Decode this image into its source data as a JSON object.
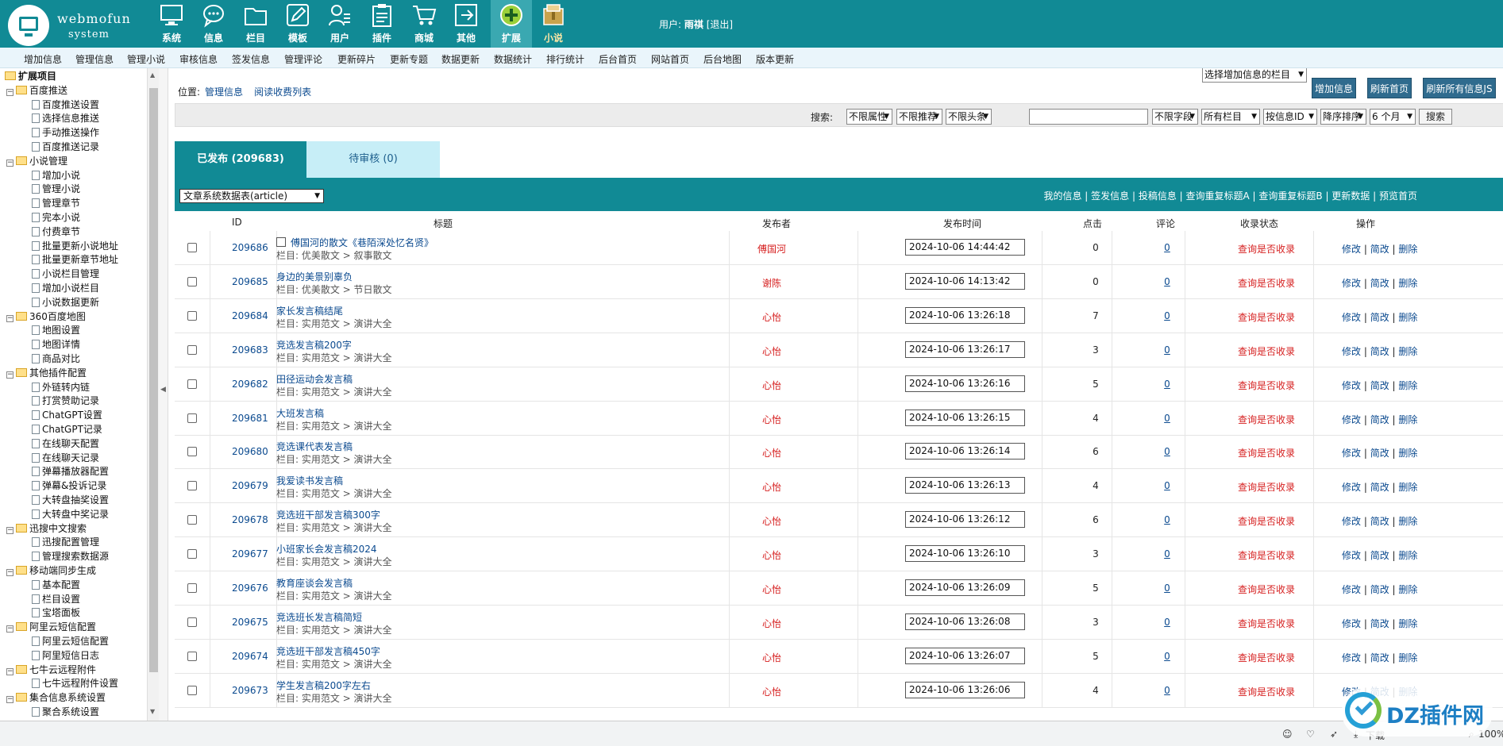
{
  "logo": {
    "name": "webmofun",
    "sub": "system"
  },
  "top_modules": [
    {
      "label": "系统",
      "icon": "monitor-icon"
    },
    {
      "label": "信息",
      "icon": "chat-icon"
    },
    {
      "label": "栏目",
      "icon": "folder-icon"
    },
    {
      "label": "模板",
      "icon": "pencil-icon"
    },
    {
      "label": "用户",
      "icon": "user-icon"
    },
    {
      "label": "插件",
      "icon": "clipboard-icon"
    },
    {
      "label": "商城",
      "icon": "cart-icon"
    },
    {
      "label": "其他",
      "icon": "exit-icon"
    },
    {
      "label": "扩展",
      "icon": "plus-circle-icon"
    },
    {
      "label": "小说",
      "icon": "book-box-icon"
    }
  ],
  "user": {
    "prefix": "用户:",
    "name": "雨祺",
    "logout": "[退出]"
  },
  "menu": [
    "增加信息",
    "管理信息",
    "管理小说",
    "审核信息",
    "签发信息",
    "管理评论",
    "更新碎片",
    "更新专题",
    "数据更新",
    "数据统计",
    "排行统计",
    "后台首页",
    "网站首页",
    "后台地图",
    "版本更新"
  ],
  "tree": [
    {
      "label": "扩展项目",
      "level": 0
    },
    {
      "label": "百度推送",
      "level": 1
    },
    {
      "label": "百度推送设置",
      "level": 2
    },
    {
      "label": "选择信息推送",
      "level": 2
    },
    {
      "label": "手动推送操作",
      "level": 2
    },
    {
      "label": "百度推送记录",
      "level": 2
    },
    {
      "label": "小说管理",
      "level": 1
    },
    {
      "label": "增加小说",
      "level": 2
    },
    {
      "label": "管理小说",
      "level": 2
    },
    {
      "label": "管理章节",
      "level": 2
    },
    {
      "label": "完本小说",
      "level": 2
    },
    {
      "label": "付费章节",
      "level": 2
    },
    {
      "label": "批量更新小说地址",
      "level": 2
    },
    {
      "label": "批量更新章节地址",
      "level": 2
    },
    {
      "label": "小说栏目管理",
      "level": 2
    },
    {
      "label": "增加小说栏目",
      "level": 2
    },
    {
      "label": "小说数据更新",
      "level": 2
    },
    {
      "label": "360百度地图",
      "level": 1
    },
    {
      "label": "地图设置",
      "level": 2
    },
    {
      "label": "地图详情",
      "level": 2
    },
    {
      "label": "商品对比",
      "level": 2
    },
    {
      "label": "其他插件配置",
      "level": 1
    },
    {
      "label": "外链转内链",
      "level": 2
    },
    {
      "label": "打赏赞助记录",
      "level": 2
    },
    {
      "label": "ChatGPT设置",
      "level": 2
    },
    {
      "label": "ChatGPT记录",
      "level": 2
    },
    {
      "label": "在线聊天配置",
      "level": 2
    },
    {
      "label": "在线聊天记录",
      "level": 2
    },
    {
      "label": "弹幕播放器配置",
      "level": 2
    },
    {
      "label": "弹幕&投诉记录",
      "level": 2
    },
    {
      "label": "大转盘抽奖设置",
      "level": 2
    },
    {
      "label": "大转盘中奖记录",
      "level": 2
    },
    {
      "label": "迅搜中文搜索",
      "level": 1
    },
    {
      "label": "迅搜配置管理",
      "level": 2
    },
    {
      "label": "管理搜索数据源",
      "level": 2
    },
    {
      "label": "移动端同步生成",
      "level": 1
    },
    {
      "label": "基本配置",
      "level": 2
    },
    {
      "label": "栏目设置",
      "level": 2
    },
    {
      "label": "宝塔面板",
      "level": 2
    },
    {
      "label": "阿里云短信配置",
      "level": 1
    },
    {
      "label": "阿里云短信配置",
      "level": 2
    },
    {
      "label": "阿里短信日志",
      "level": 2
    },
    {
      "label": "七牛云远程附件",
      "level": 1
    },
    {
      "label": "七牛远程附件设置",
      "level": 2
    },
    {
      "label": "集合信息系统设置",
      "level": 1
    },
    {
      "label": "聚合系统设置",
      "level": 2
    }
  ],
  "breadcrumb": {
    "label": "位置:",
    "items": [
      "管理信息",
      "阅读收费列表"
    ]
  },
  "toolbar": {
    "add_select": "选择增加信息的栏目",
    "add_btn": "增加信息",
    "refresh_home": "刷新首页",
    "refresh_js": "刷新所有信息JS"
  },
  "search": {
    "label": "搜索:",
    "filters": [
      "不限属性",
      "不限推荐",
      "不限头条"
    ],
    "keyword": "",
    "field": "不限字段",
    "column": "所有栏目",
    "order_by": "按信息ID",
    "order": "降序排序",
    "period": "6 个月",
    "button": "搜索"
  },
  "tabs": {
    "published": "已发布 (209683)",
    "pending": "待审核 (0)"
  },
  "table_select": "文章系统数据表(article)",
  "table_links": [
    "我的信息",
    "签发信息",
    "投稿信息",
    "查询重复标题A",
    "查询重复标题B",
    "更新数据",
    "预览首页"
  ],
  "columns": [
    "ID",
    "标题",
    "发布者",
    "发布时间",
    "点击",
    "评论",
    "收录状态",
    "操作"
  ],
  "rows": [
    {
      "id": "209686",
      "title": "傅国河的散文《巷陌深处忆名贤》",
      "cat": "栏目: 优美散文 > 叙事散文",
      "pub": "傅国河",
      "time": "2024-10-06 14:44:42",
      "clicks": "0",
      "comments": "0",
      "status": "查询是否收录",
      "icon": true
    },
    {
      "id": "209685",
      "title": "身边的美景别辜负",
      "cat": "栏目: 优美散文 > 节日散文",
      "pub": "谢陈",
      "time": "2024-10-06 14:13:42",
      "clicks": "0",
      "comments": "0",
      "status": "查询是否收录"
    },
    {
      "id": "209684",
      "title": "家长发言稿结尾",
      "cat": "栏目: 实用范文 > 演讲大全",
      "pub": "心怡",
      "time": "2024-10-06 13:26:18",
      "clicks": "7",
      "comments": "0",
      "status": "查询是否收录"
    },
    {
      "id": "209683",
      "title": "竞选发言稿200字",
      "cat": "栏目: 实用范文 > 演讲大全",
      "pub": "心怡",
      "time": "2024-10-06 13:26:17",
      "clicks": "3",
      "comments": "0",
      "status": "查询是否收录"
    },
    {
      "id": "209682",
      "title": "田径运动会发言稿",
      "cat": "栏目: 实用范文 > 演讲大全",
      "pub": "心怡",
      "time": "2024-10-06 13:26:16",
      "clicks": "5",
      "comments": "0",
      "status": "查询是否收录"
    },
    {
      "id": "209681",
      "title": "大班发言稿",
      "cat": "栏目: 实用范文 > 演讲大全",
      "pub": "心怡",
      "time": "2024-10-06 13:26:15",
      "clicks": "4",
      "comments": "0",
      "status": "查询是否收录"
    },
    {
      "id": "209680",
      "title": "竞选课代表发言稿",
      "cat": "栏目: 实用范文 > 演讲大全",
      "pub": "心怡",
      "time": "2024-10-06 13:26:14",
      "clicks": "6",
      "comments": "0",
      "status": "查询是否收录"
    },
    {
      "id": "209679",
      "title": "我爱读书发言稿",
      "cat": "栏目: 实用范文 > 演讲大全",
      "pub": "心怡",
      "time": "2024-10-06 13:26:13",
      "clicks": "4",
      "comments": "0",
      "status": "查询是否收录"
    },
    {
      "id": "209678",
      "title": "竞选班干部发言稿300字",
      "cat": "栏目: 实用范文 > 演讲大全",
      "pub": "心怡",
      "time": "2024-10-06 13:26:12",
      "clicks": "6",
      "comments": "0",
      "status": "查询是否收录"
    },
    {
      "id": "209677",
      "title": "小班家长会发言稿2024",
      "cat": "栏目: 实用范文 > 演讲大全",
      "pub": "心怡",
      "time": "2024-10-06 13:26:10",
      "clicks": "3",
      "comments": "0",
      "status": "查询是否收录"
    },
    {
      "id": "209676",
      "title": "教育座谈会发言稿",
      "cat": "栏目: 实用范文 > 演讲大全",
      "pub": "心怡",
      "time": "2024-10-06 13:26:09",
      "clicks": "5",
      "comments": "0",
      "status": "查询是否收录"
    },
    {
      "id": "209675",
      "title": "竞选班长发言稿简短",
      "cat": "栏目: 实用范文 > 演讲大全",
      "pub": "心怡",
      "time": "2024-10-06 13:26:08",
      "clicks": "3",
      "comments": "0",
      "status": "查询是否收录"
    },
    {
      "id": "209674",
      "title": "竞选班干部发言稿450字",
      "cat": "栏目: 实用范文 > 演讲大全",
      "pub": "心怡",
      "time": "2024-10-06 13:26:07",
      "clicks": "5",
      "comments": "0",
      "status": "查询是否收录"
    },
    {
      "id": "209673",
      "title": "学生发言稿200字左右",
      "cat": "栏目: 实用范文 > 演讲大全",
      "pub": "心怡",
      "time": "2024-10-06 13:26:06",
      "clicks": "4",
      "comments": "0",
      "status": "查询是否收录"
    }
  ],
  "row_ops": [
    "修改",
    "简改",
    "删除"
  ],
  "statusbar": {
    "download": "下载",
    "zoom": "100%"
  },
  "watermark": "DZ插件网",
  "colors": {
    "header": "#118a95",
    "link": "#0b4a8f",
    "red": "#d62020",
    "button": "#2f6b8e"
  }
}
